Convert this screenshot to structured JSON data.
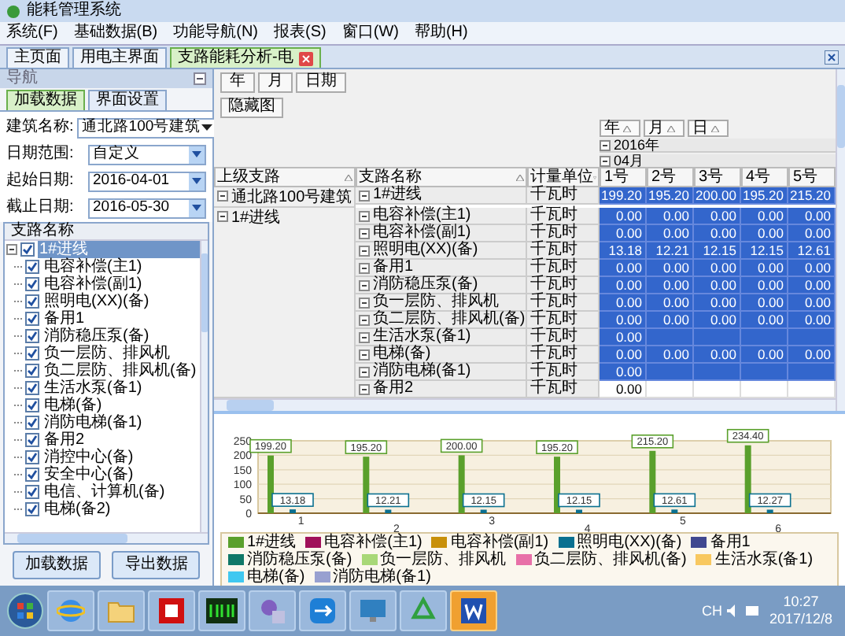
{
  "window": {
    "title": "能耗管理系统"
  },
  "menu": [
    "系统(F)",
    "基础数据(B)",
    "功能导航(N)",
    "报表(S)",
    "窗口(W)",
    "帮助(H)"
  ],
  "tabs": [
    {
      "label": "主页面",
      "selected": false,
      "closable": false
    },
    {
      "label": "用电主界面",
      "selected": false,
      "closable": false
    },
    {
      "label": "支路能耗分析-电",
      "selected": true,
      "closable": true
    }
  ],
  "nav_panel": {
    "title": "导航",
    "subtabs": [
      {
        "label": "加载数据",
        "selected": true
      },
      {
        "label": "界面设置",
        "selected": false
      }
    ],
    "fields": [
      {
        "label": "建筑名称:",
        "value": "通北路100号建筑",
        "kind": "dropdown"
      },
      {
        "label": "日期范围:",
        "value": "自定义",
        "kind": "combo"
      },
      {
        "label": "起始日期:",
        "value": "2016-04-01",
        "kind": "combo"
      },
      {
        "label": "截止日期:",
        "value": "2016-05-30",
        "kind": "combo"
      }
    ],
    "tree": {
      "header": "支路名称",
      "items": [
        {
          "label": "1#进线",
          "checked": true,
          "selected": true,
          "children": [
            {
              "label": "电容补偿(主1)",
              "checked": true,
              "selected": false
            },
            {
              "label": "电容补偿(副1)",
              "checked": true,
              "selected": false
            },
            {
              "label": "照明电(XX)(备)",
              "checked": true,
              "selected": false
            },
            {
              "label": "备用1",
              "checked": true,
              "selected": false
            },
            {
              "label": "消防稳压泵(备)",
              "checked": true,
              "selected": false
            },
            {
              "label": "负一层防、排风机",
              "checked": true,
              "selected": false
            },
            {
              "label": "负二层防、排风机(备)",
              "checked": true,
              "selected": false
            },
            {
              "label": "生活水泵(备1)",
              "checked": true,
              "selected": false
            },
            {
              "label": "电梯(备)",
              "checked": true,
              "selected": false
            },
            {
              "label": "消防电梯(备1)",
              "checked": true,
              "selected": false
            },
            {
              "label": "备用2",
              "checked": true,
              "selected": false
            },
            {
              "label": "消控中心(备)",
              "checked": true,
              "selected": false
            },
            {
              "label": "安全中心(备)",
              "checked": true,
              "selected": false
            },
            {
              "label": "电信、计算机(备)",
              "checked": true,
              "selected": false
            },
            {
              "label": "电梯(备2)",
              "checked": true,
              "selected": false
            }
          ]
        }
      ]
    },
    "buttons": [
      "加载数据",
      "导出数据"
    ]
  },
  "grid": {
    "period_buttons": [
      "年",
      "月",
      "日期"
    ],
    "toggle_button": "隐藏图",
    "group_levels": [
      "年",
      "月",
      "日"
    ],
    "year": "2016年",
    "month": "04月",
    "columns": [
      {
        "label": "上级支路"
      },
      {
        "label": "支路名称"
      },
      {
        "label": "计量单位"
      }
    ],
    "day_columns": [
      "1号",
      "2号",
      "3号",
      "4号",
      "5号"
    ],
    "groups": [
      {
        "parent": "通北路100号建筑",
        "rows": [
          {
            "name": "1#进线",
            "unit": "千瓦时",
            "values": [
              "199.20",
              "195.20",
              "200.00",
              "195.20",
              "215.20"
            ],
            "selected": true
          }
        ]
      },
      {
        "parent": "1#进线",
        "rows": [
          {
            "name": "电容补偿(主1)",
            "unit": "千瓦时",
            "values": [
              "0.00",
              "0.00",
              "0.00",
              "0.00",
              "0.00"
            ],
            "selected": true
          },
          {
            "name": "电容补偿(副1)",
            "unit": "千瓦时",
            "values": [
              "0.00",
              "0.00",
              "0.00",
              "0.00",
              "0.00"
            ],
            "selected": true
          },
          {
            "name": "照明电(XX)(备)",
            "unit": "千瓦时",
            "values": [
              "13.18",
              "12.21",
              "12.15",
              "12.15",
              "12.61"
            ],
            "selected": true
          },
          {
            "name": "备用1",
            "unit": "千瓦时",
            "values": [
              "0.00",
              "0.00",
              "0.00",
              "0.00",
              "0.00"
            ],
            "selected": true
          },
          {
            "name": "消防稳压泵(备)",
            "unit": "千瓦时",
            "values": [
              "0.00",
              "0.00",
              "0.00",
              "0.00",
              "0.00"
            ],
            "selected": true
          },
          {
            "name": "负一层防、排风机",
            "unit": "千瓦时",
            "values": [
              "0.00",
              "0.00",
              "0.00",
              "0.00",
              "0.00"
            ],
            "selected": true
          },
          {
            "name": "负二层防、排风机(备)",
            "unit": "千瓦时",
            "values": [
              "0.00",
              "0.00",
              "0.00",
              "0.00",
              "0.00"
            ],
            "selected": true
          },
          {
            "name": "生活水泵(备1)",
            "unit": "千瓦时",
            "values": [
              "0.00"
            ],
            "selected": true
          },
          {
            "name": "电梯(备)",
            "unit": "千瓦时",
            "values": [
              "0.00",
              "0.00",
              "0.00",
              "0.00",
              "0.00"
            ],
            "selected": true
          },
          {
            "name": "消防电梯(备1)",
            "unit": "千瓦时",
            "values": [
              "0.00"
            ],
            "selected": true
          },
          {
            "name": "备用2",
            "unit": "千瓦时",
            "values": [
              "0.00"
            ],
            "selected": false
          }
        ]
      }
    ]
  },
  "chart": {
    "chart_data": {
      "type": "bar",
      "categories": [
        "1",
        "2",
        "3",
        "4",
        "5",
        "6"
      ],
      "series": [
        {
          "name": "1#进线",
          "color": "#5aa02c",
          "values": [
            199.2,
            195.2,
            200.0,
            195.2,
            215.2,
            234.4
          ],
          "value_labels": [
            "199.20",
            "195.20",
            "200.00",
            "195.20",
            "215.20",
            "234.40"
          ]
        },
        {
          "name": "电容补偿(主1)",
          "color": "#a0105a",
          "values": [
            0,
            0,
            0,
            0,
            0,
            0
          ]
        },
        {
          "name": "电容补偿(副1)",
          "color": "#c8900a",
          "values": [
            0,
            0,
            0,
            0,
            0,
            0
          ]
        },
        {
          "name": "照明电(XX)(备)",
          "color": "#0a7090",
          "values": [
            13.18,
            12.21,
            12.15,
            12.15,
            12.61,
            12.27
          ],
          "value_labels": [
            "13.18",
            "12.21",
            "12.15",
            "12.15",
            "12.61",
            "12.27"
          ]
        },
        {
          "name": "备用1",
          "color": "#404890",
          "values": [
            0,
            0,
            0,
            0,
            0,
            0
          ]
        },
        {
          "name": "消防稳压泵(备)",
          "color": "#107868",
          "values": [
            0,
            0,
            0,
            0,
            0,
            0
          ]
        },
        {
          "name": "负一层防、排风机",
          "color": "#a8d878",
          "values": [
            0,
            0,
            0,
            0,
            0,
            0
          ]
        },
        {
          "name": "负二层防、排风机(备)",
          "color": "#e870a8",
          "values": [
            0,
            0,
            0,
            0,
            0,
            0
          ]
        },
        {
          "name": "生活水泵(备1)",
          "color": "#f8c860",
          "values": [
            0,
            0,
            0,
            0,
            0,
            0
          ]
        },
        {
          "name": "电梯(备)",
          "color": "#40c8f0",
          "values": [
            0,
            0,
            0,
            0,
            0,
            0
          ]
        },
        {
          "name": "消防电梯(备1)",
          "color": "#98a0d0",
          "values": [
            0,
            0,
            0,
            0,
            0,
            0
          ]
        }
      ],
      "ylim": [
        0,
        250
      ],
      "yticks": [
        0,
        50,
        100,
        150,
        200,
        250
      ],
      "grid": true
    }
  },
  "taskbar": {
    "apps": [
      {
        "kind": "browser",
        "active": false
      },
      {
        "kind": "folder",
        "active": false
      },
      {
        "kind": "red-app",
        "active": false
      },
      {
        "kind": "meter",
        "active": false
      },
      {
        "kind": "tool",
        "active": false
      },
      {
        "kind": "remote",
        "active": false
      },
      {
        "kind": "panel",
        "active": false
      },
      {
        "kind": "recycle",
        "active": false
      },
      {
        "kind": "word",
        "active": true
      }
    ],
    "ime": "CH",
    "time": "10:27",
    "date": "2017/12/8"
  }
}
